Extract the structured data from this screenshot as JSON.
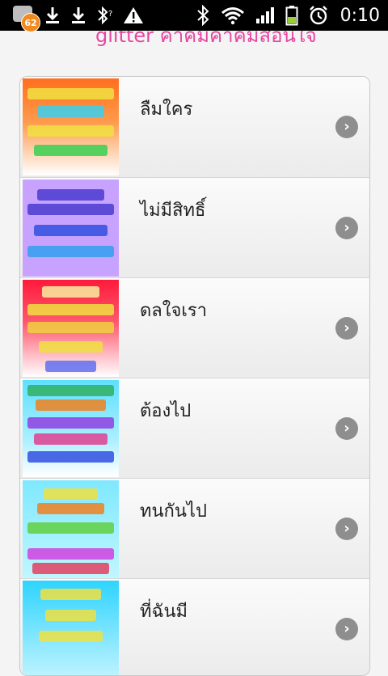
{
  "status_bar": {
    "notification_count": "62",
    "time": "0:10"
  },
  "header": {
    "title": "glitter คำคมคำคมสอนใจ"
  },
  "list": {
    "items": [
      {
        "title": "ลืมใคร",
        "thumb_colors": [
          "#ff7a2a",
          "#ffffff"
        ]
      },
      {
        "title": "ไม่มีสิทธิ์",
        "thumb_colors": [
          "#c9a6ff",
          "#c9a6ff"
        ]
      },
      {
        "title": "ดลใจเรา",
        "thumb_colors": [
          "#ff1e3c",
          "#ffffff"
        ]
      },
      {
        "title": "ต้องไป",
        "thumb_colors": [
          "#66e3ff",
          "#ffffff"
        ]
      },
      {
        "title": "ทนกันไป",
        "thumb_colors": [
          "#7fe8ff",
          "#bff6ff"
        ]
      },
      {
        "title": "ที่ฉันมี",
        "thumb_colors": [
          "#33d6ff",
          "#bff3ff"
        ]
      }
    ]
  },
  "colors": {
    "header_title": "#e646a0",
    "notification_badge": "#f08a1d",
    "chevron": "#8e8e8e"
  }
}
